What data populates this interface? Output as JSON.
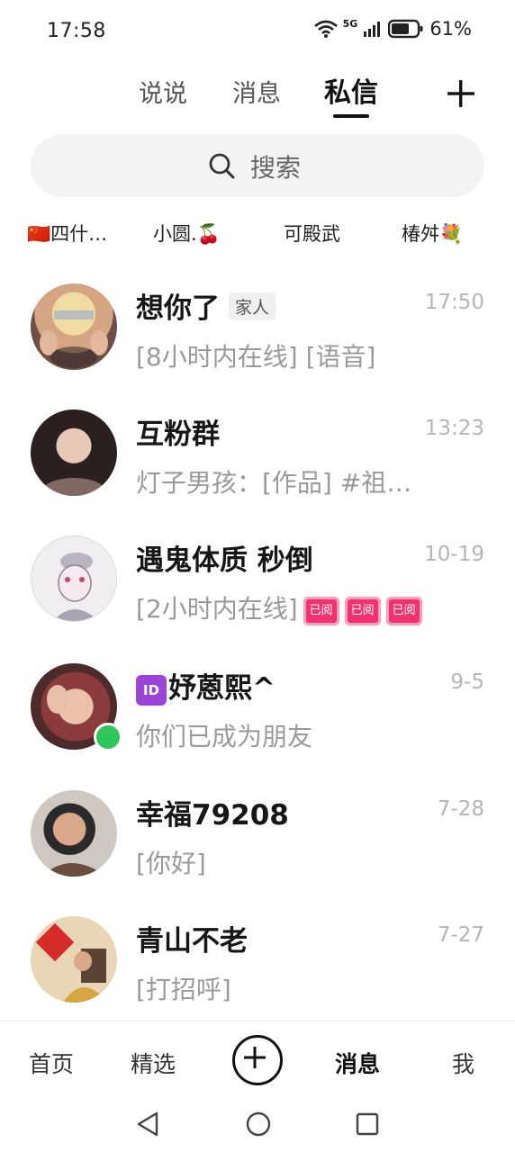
{
  "status_bar": {
    "time": "17:58",
    "network": "5G",
    "battery_percent": "61%"
  },
  "tabs": [
    {
      "label": "说说"
    },
    {
      "label": "消息"
    },
    {
      "label": "私信",
      "active": true
    }
  ],
  "search": {
    "placeholder": "搜索"
  },
  "friends": [
    {
      "label": "🇨🇳四什…"
    },
    {
      "label": "小圆.🍒"
    },
    {
      "label": "可殿武"
    },
    {
      "label": "椿舛💐"
    }
  ],
  "conversations": [
    {
      "name": "想你了",
      "tag": "家人",
      "message": "[8小时内在线] [语音]",
      "time": "17:50"
    },
    {
      "name": "互粉群",
      "message": "灯子男孩：[作品] #祖…",
      "time": "13:23"
    },
    {
      "name": "遇鬼体质  秒倒",
      "message": "[2小时内在线]",
      "read_badges": [
        "已阅",
        "已阅",
        "已阅"
      ],
      "time": "10-19"
    },
    {
      "name_badge": "ID",
      "name": "妤蒽熙^",
      "message": "你们已成为朋友",
      "time": "9-5",
      "online": true
    },
    {
      "name": "幸福79208",
      "message": "[你好]",
      "time": "7-28"
    },
    {
      "name": "青山不老",
      "message": "[打招呼]",
      "time": "7-27"
    }
  ],
  "bottom_nav": [
    {
      "label": "首页"
    },
    {
      "label": "精选"
    },
    {
      "label": "消息",
      "active": true
    },
    {
      "label": "我"
    }
  ],
  "colors": {
    "online": "#2ec55b",
    "read_badge": "#f0326e",
    "id_badge": "#9b44d8"
  }
}
